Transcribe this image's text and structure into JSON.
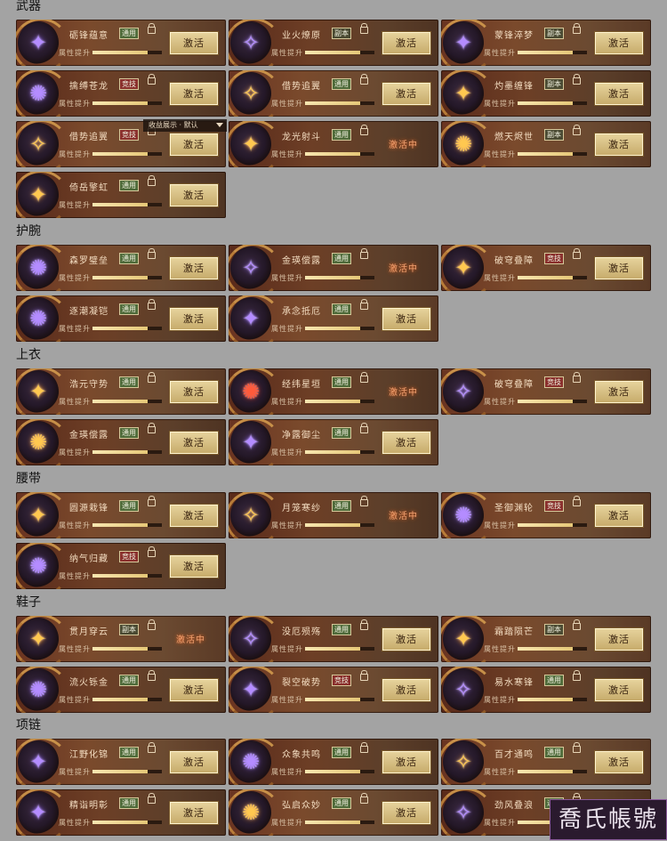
{
  "dropdown": {
    "label": "收益展示 · 默认"
  },
  "watermark": "喬氏帳號",
  "sections": [
    {
      "title": "武器",
      "cards": [
        {
          "name": "砺锋蕴意",
          "tag": "通用",
          "tagType": "t-ty",
          "glyph": "✦",
          "color": "g-purple",
          "state": "activate",
          "progress": 0.8
        },
        {
          "name": "业火燎原",
          "tag": "副本",
          "tagType": "t-fb",
          "glyph": "✧",
          "color": "g-purple",
          "state": "activate",
          "progress": 0.8
        },
        {
          "name": "蒙锋淬梦",
          "tag": "副本",
          "tagType": "t-fb",
          "glyph": "✦",
          "color": "g-purple",
          "state": "activate",
          "progress": 0.8
        },
        {
          "name": "擒缚苍龙",
          "tag": "竞技",
          "tagType": "t-jj",
          "glyph": "✺",
          "color": "g-purple",
          "state": "activate",
          "progress": 0.8
        },
        {
          "name": "借势追翼",
          "tag": "通用",
          "tagType": "t-ty",
          "glyph": "✧",
          "color": "g-gold",
          "state": "activate",
          "progress": 0.8
        },
        {
          "name": "灼墨缠锋",
          "tag": "副本",
          "tagType": "t-fb",
          "glyph": "✦",
          "color": "g-gold",
          "state": "activate",
          "progress": 0.8
        },
        {
          "name": "借势追翼",
          "tag": "竞技",
          "tagType": "t-jj",
          "glyph": "✧",
          "color": "g-gold",
          "state": "activate",
          "progress": 0.8
        },
        {
          "name": "龙光射斗",
          "tag": "通用",
          "tagType": "t-ty",
          "glyph": "✦",
          "color": "g-gold",
          "state": "activating",
          "progress": 0.8
        },
        {
          "name": "燃天烬世",
          "tag": "副本",
          "tagType": "t-fb",
          "glyph": "✺",
          "color": "g-gold",
          "state": "activate",
          "progress": 0.8
        },
        {
          "name": "倚岳擎虹",
          "tag": "通用",
          "tagType": "t-ty",
          "glyph": "✦",
          "color": "g-gold",
          "state": "activate",
          "progress": 0.8
        }
      ]
    },
    {
      "title": "护腕",
      "cards": [
        {
          "name": "森罗璧垒",
          "tag": "通用",
          "tagType": "t-ty",
          "glyph": "✺",
          "color": "g-purple",
          "state": "activate",
          "progress": 0.8
        },
        {
          "name": "金瑛偿露",
          "tag": "通用",
          "tagType": "t-ty",
          "glyph": "✧",
          "color": "g-purple",
          "state": "activating",
          "progress": 0.8
        },
        {
          "name": "破穹叠障",
          "tag": "竞技",
          "tagType": "t-jj",
          "glyph": "✦",
          "color": "g-gold",
          "state": "activate",
          "progress": 0.8
        },
        {
          "name": "逐潮凝铠",
          "tag": "通用",
          "tagType": "t-ty",
          "glyph": "✺",
          "color": "g-purple",
          "state": "activate",
          "progress": 0.8
        },
        {
          "name": "承念抵厄",
          "tag": "通用",
          "tagType": "t-ty",
          "glyph": "✦",
          "color": "g-purple",
          "state": "activate",
          "progress": 0.8
        }
      ]
    },
    {
      "title": "上衣",
      "cards": [
        {
          "name": "浩元守势",
          "tag": "通用",
          "tagType": "t-ty",
          "glyph": "✦",
          "color": "g-gold",
          "state": "activate",
          "progress": 0.8
        },
        {
          "name": "经纬星垣",
          "tag": "通用",
          "tagType": "t-ty",
          "glyph": "✺",
          "color": "g-red",
          "state": "activating",
          "progress": 0.8
        },
        {
          "name": "破穹叠障",
          "tag": "竞技",
          "tagType": "t-jj",
          "glyph": "✧",
          "color": "g-purple",
          "state": "activate",
          "progress": 0.8
        },
        {
          "name": "金瑛偿露",
          "tag": "通用",
          "tagType": "t-ty",
          "glyph": "✺",
          "color": "g-gold",
          "state": "activate",
          "progress": 0.8
        },
        {
          "name": "净露御尘",
          "tag": "通用",
          "tagType": "t-ty",
          "glyph": "✦",
          "color": "g-purple",
          "state": "activate",
          "progress": 0.8
        }
      ]
    },
    {
      "title": "腰带",
      "cards": [
        {
          "name": "圆源栽锋",
          "tag": "通用",
          "tagType": "t-ty",
          "glyph": "✦",
          "color": "g-gold",
          "state": "activate",
          "progress": 0.8
        },
        {
          "name": "月笼寒纱",
          "tag": "通用",
          "tagType": "t-ty",
          "glyph": "✧",
          "color": "g-gold",
          "state": "activating",
          "progress": 0.8
        },
        {
          "name": "圣御渊轮",
          "tag": "竞技",
          "tagType": "t-jj",
          "glyph": "✺",
          "color": "g-purple",
          "state": "activate",
          "progress": 0.8
        },
        {
          "name": "纳气归藏",
          "tag": "竞技",
          "tagType": "t-jj",
          "glyph": "✺",
          "color": "g-purple",
          "state": "activate",
          "progress": 0.8
        }
      ]
    },
    {
      "title": "鞋子",
      "cards": [
        {
          "name": "贯月穿云",
          "tag": "副本",
          "tagType": "t-fb",
          "glyph": "✦",
          "color": "g-gold",
          "state": "activating",
          "progress": 0.8
        },
        {
          "name": "没厄殒殇",
          "tag": "通用",
          "tagType": "t-ty",
          "glyph": "✧",
          "color": "g-purple",
          "state": "activate",
          "progress": 0.8
        },
        {
          "name": "霜踏陨芒",
          "tag": "副本",
          "tagType": "t-fb",
          "glyph": "✦",
          "color": "g-gold",
          "state": "activate",
          "progress": 0.8
        },
        {
          "name": "流火铄金",
          "tag": "通用",
          "tagType": "t-ty",
          "glyph": "✺",
          "color": "g-purple",
          "state": "activate",
          "progress": 0.8
        },
        {
          "name": "裂空破势",
          "tag": "竞技",
          "tagType": "t-jj",
          "glyph": "✦",
          "color": "g-purple",
          "state": "activate",
          "progress": 0.8
        },
        {
          "name": "易水寒锋",
          "tag": "通用",
          "tagType": "t-ty",
          "glyph": "✧",
          "color": "g-purple",
          "state": "activate",
          "progress": 0.8
        }
      ]
    },
    {
      "title": "项链",
      "cards": [
        {
          "name": "江野化锦",
          "tag": "通用",
          "tagType": "t-ty",
          "glyph": "✦",
          "color": "g-purple",
          "state": "activate",
          "progress": 0.8
        },
        {
          "name": "众象共鸣",
          "tag": "通用",
          "tagType": "t-ty",
          "glyph": "✺",
          "color": "g-purple",
          "state": "activate",
          "progress": 0.8
        },
        {
          "name": "百才通鸣",
          "tag": "通用",
          "tagType": "t-ty",
          "glyph": "✧",
          "color": "g-gold",
          "state": "activate",
          "progress": 0.8
        },
        {
          "name": "精诣明彰",
          "tag": "通用",
          "tagType": "t-ty",
          "glyph": "✦",
          "color": "g-purple",
          "state": "activate",
          "progress": 0.8
        },
        {
          "name": "弘启众妙",
          "tag": "通用",
          "tagType": "t-ty",
          "glyph": "✺",
          "color": "g-gold",
          "state": "activate",
          "progress": 0.8
        },
        {
          "name": "劲风叠浪",
          "tag": "通用",
          "tagType": "t-ty",
          "glyph": "✧",
          "color": "g-purple",
          "state": "activate",
          "progress": 0.8
        }
      ]
    }
  ],
  "labels": {
    "attr": "属性提升",
    "activate": "激活",
    "activating": "激活中"
  }
}
